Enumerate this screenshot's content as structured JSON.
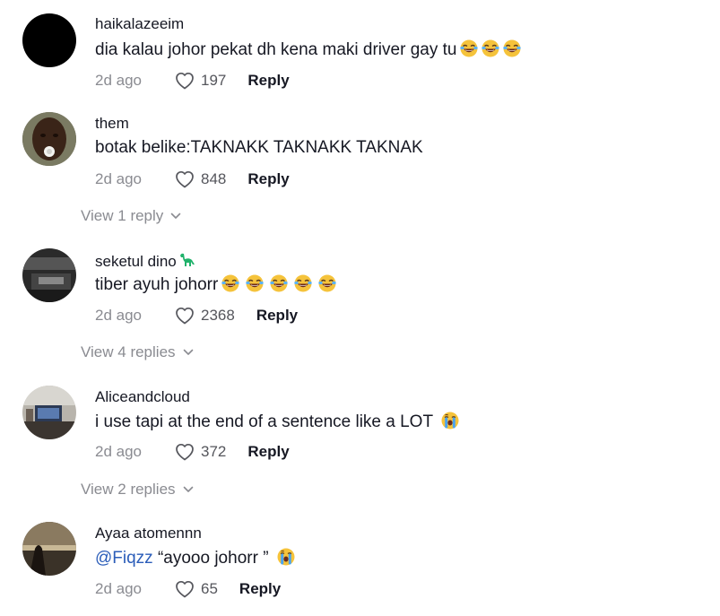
{
  "comments": [
    {
      "username": "haikalazeeim",
      "text": "dia kalau johor pekat dh kena maki driver gay tu",
      "emojis": [
        "joy-emoji",
        "joy-emoji",
        "joy-emoji"
      ],
      "time": "2d ago",
      "likes": "197",
      "reply_label": "Reply"
    },
    {
      "username": "them",
      "text": "botak belike:TAKNAKK TAKNAKK TAKNAK",
      "time": "2d ago",
      "likes": "848",
      "reply_label": "Reply",
      "view_replies": "View 1 reply"
    },
    {
      "username": "seketul dino",
      "text": "tiber ayuh johorr",
      "emojis": [
        "joy-emoji",
        "joy-emoji",
        "joy-emoji",
        "joy-emoji",
        "joy-emoji"
      ],
      "time": "2d ago",
      "likes": "2368",
      "reply_label": "Reply",
      "view_replies": "View 4 replies"
    },
    {
      "username": "Aliceandcloud",
      "text": "i use tapi at the end of a sentence like a LOT",
      "emojis": [
        "crying-emoji"
      ],
      "time": "2d ago",
      "likes": "372",
      "reply_label": "Reply",
      "view_replies": "View 2 replies"
    },
    {
      "username": "Ayaa  atomennn",
      "mention": "@Fiqzz",
      "text": " “ayooo johorr ”",
      "emojis": [
        "crying-emoji"
      ],
      "time": "2d ago",
      "likes": "65",
      "reply_label": "Reply"
    }
  ],
  "colors": {
    "text": "#161823",
    "muted": "#8a8b91",
    "mention": "#2b5db9",
    "dino": "#20b26b"
  }
}
